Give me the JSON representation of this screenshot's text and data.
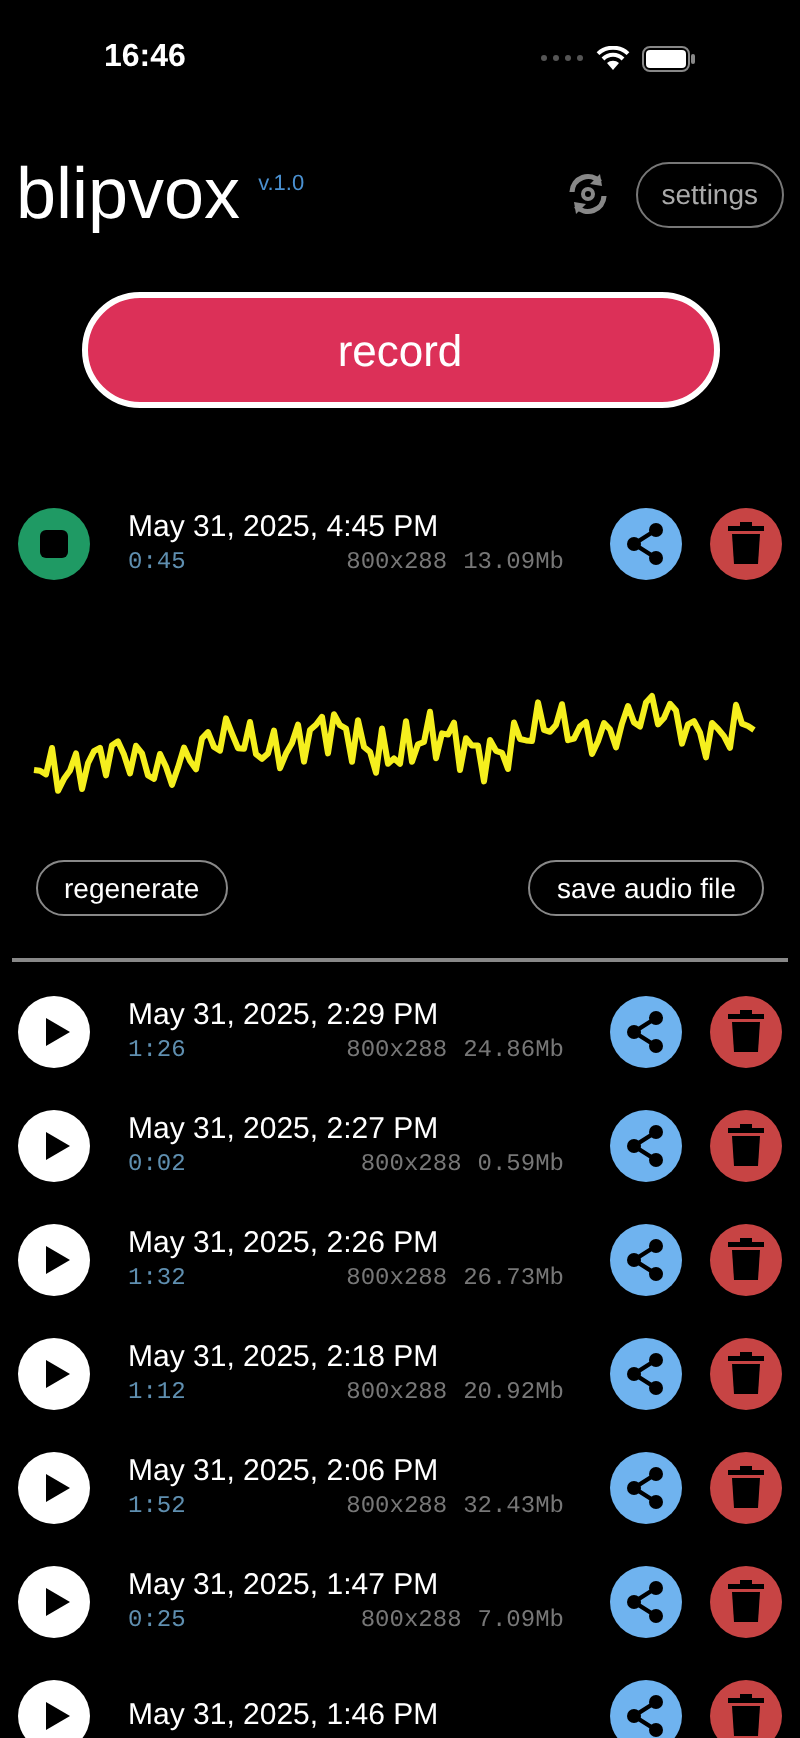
{
  "status_bar": {
    "time": "16:46"
  },
  "header": {
    "title": "blipvox",
    "version": "v.1.0",
    "settings_button": "settings"
  },
  "record_button": "record",
  "current": {
    "date": "May 31, 2025, 4:45 PM",
    "duration": "0:45",
    "dimensions": "800x288",
    "size": "13.09Mb",
    "playing": true,
    "actions": [
      "regenerate",
      "save audio file"
    ]
  },
  "recordings": [
    {
      "date": "May 31, 2025, 2:29 PM",
      "duration": "1:26",
      "dimensions": "800x288",
      "size": "24.86Mb",
      "playing": false
    },
    {
      "date": "May 31, 2025, 2:27 PM",
      "duration": "0:02",
      "dimensions": "800x288",
      "size": "0.59Mb",
      "playing": false
    },
    {
      "date": "May 31, 2025, 2:26 PM",
      "duration": "1:32",
      "dimensions": "800x288",
      "size": "26.73Mb",
      "playing": false
    },
    {
      "date": "May 31, 2025, 2:18 PM",
      "duration": "1:12",
      "dimensions": "800x288",
      "size": "20.92Mb",
      "playing": false
    },
    {
      "date": "May 31, 2025, 2:06 PM",
      "duration": "1:52",
      "dimensions": "800x288",
      "size": "32.43Mb",
      "playing": false
    },
    {
      "date": "May 31, 2025, 1:47 PM",
      "duration": "0:25",
      "dimensions": "800x288",
      "size": "7.09Mb",
      "playing": false
    },
    {
      "date": "May 31, 2025, 1:46 PM",
      "playing": false
    }
  ]
}
